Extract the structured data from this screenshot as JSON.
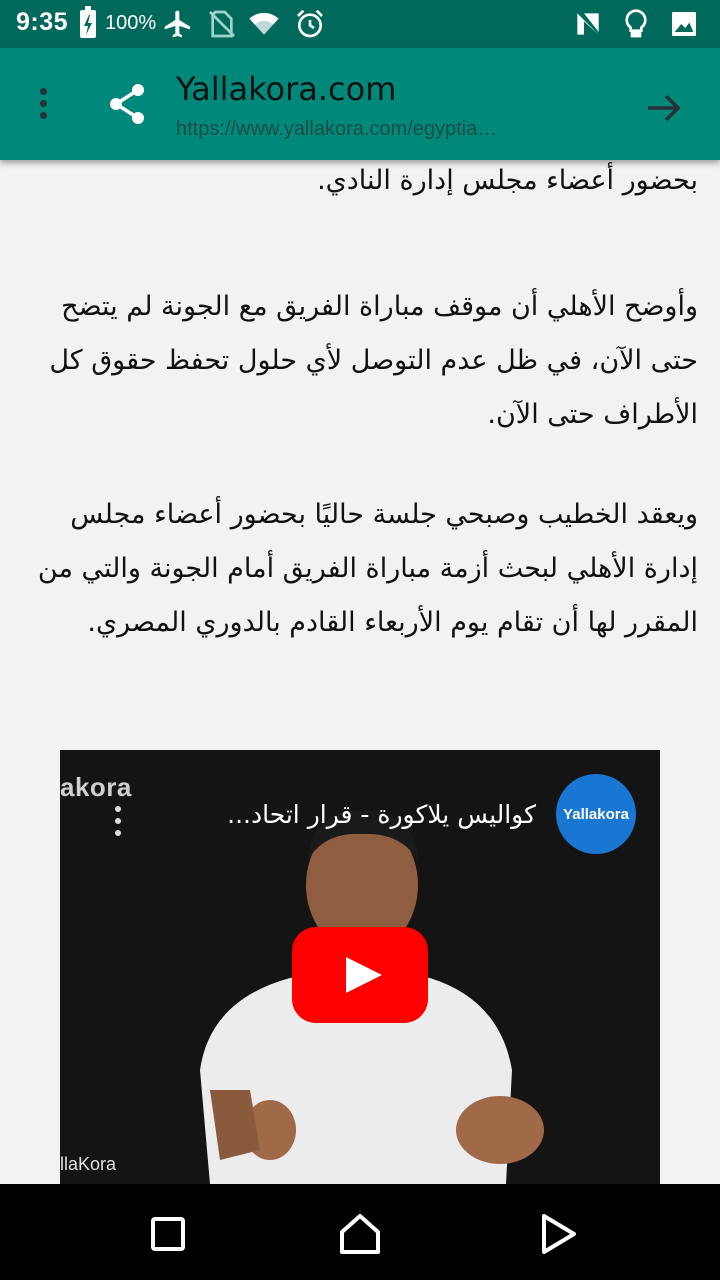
{
  "status_bar": {
    "time": "9:35",
    "battery": "100%",
    "icons": [
      "battery-charging-icon",
      "airplane-mode-icon",
      "no-sim-icon",
      "wifi-icon",
      "alarm-icon",
      "n-notification-icon",
      "lightbulb-icon",
      "image-icon"
    ]
  },
  "app_bar": {
    "title": "Yallakora.com",
    "url": "https://www.yallakora.com/egyptia…",
    "icons": [
      "more-vert-icon",
      "share-icon",
      "arrow-forward-icon"
    ]
  },
  "article": {
    "paragraphs": [
      "وزير الرياضة مع الخطيب في الفترة الأخيرة أن تستمر بحضور أعضاء مجلس إدارة النادي.",
      "وأوضح الأهلي أن موقف مباراة الفريق مع الجونة لم يتضح حتى الآن، في ظل عدم التوصل لأي حلول تحفظ حقوق كل الأطراف حتى الآن.",
      "ويعقد الخطيب وصبحي جلسة حاليًا بحضور أعضاء مجلس إدارة الأهلي لبحث أزمة مباراة الفريق أمام الجونة والتي من المقرر لها أن تقام يوم الأربعاء القادم بالدوري المصري."
    ]
  },
  "video": {
    "title": "كواليس يلاكورة - قرار اتحاد...",
    "channel_logo_text": "Yallakora",
    "watermark_top": "akora",
    "watermark_bottom": "llaKora"
  },
  "nav_bar": {
    "icons": [
      "recents-square-icon",
      "home-icon",
      "back-triangle-icon"
    ]
  },
  "colors": {
    "status_bar": "#00695c",
    "app_bar": "#00897b",
    "page_background": "#f2f2f2",
    "youtube_red": "#ff0000",
    "channel_blue": "#1976d2"
  }
}
